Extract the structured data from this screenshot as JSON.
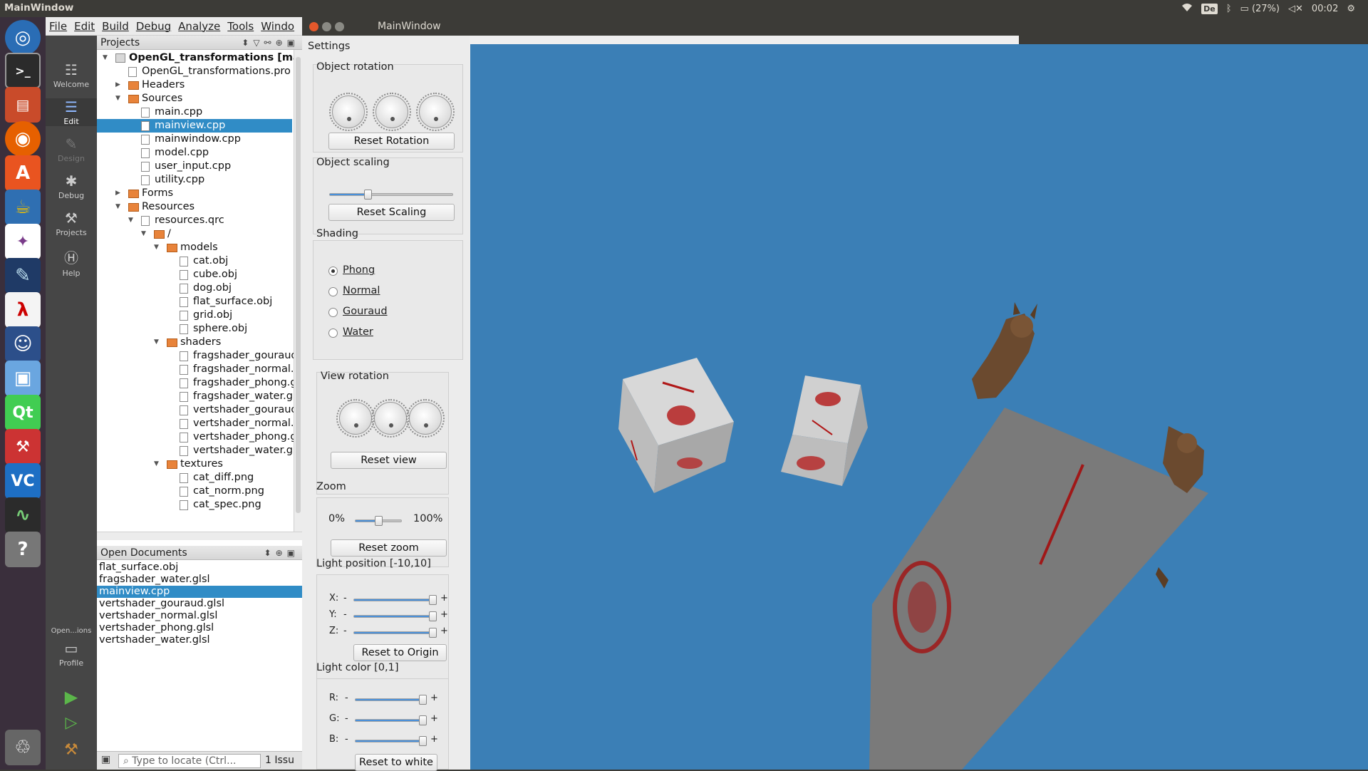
{
  "topbar": {
    "title": "MainWindow",
    "kb": "De",
    "battery": "(27%)",
    "time": "00:02"
  },
  "menu": [
    "File",
    "Edit",
    "Build",
    "Debug",
    "Analyze",
    "Tools",
    "Windo"
  ],
  "modes": [
    "Welcome",
    "Edit",
    "Design",
    "Debug",
    "Projects",
    "Help",
    "Open...ions",
    "Profile"
  ],
  "projects": {
    "header": "Projects",
    "tree": [
      {
        "label": "OpenGL_transformations [maste",
        "level": 0,
        "arrow": "open",
        "icon": "proj",
        "bold": true
      },
      {
        "label": "OpenGL_transformations.pro",
        "level": 1,
        "arrow": "",
        "icon": "file"
      },
      {
        "label": "Headers",
        "level": 1,
        "arrow": "closed",
        "icon": "folder"
      },
      {
        "label": "Sources",
        "level": 1,
        "arrow": "open",
        "icon": "folder"
      },
      {
        "label": "main.cpp",
        "level": 2,
        "arrow": "",
        "icon": "file"
      },
      {
        "label": "mainview.cpp",
        "level": 2,
        "arrow": "",
        "icon": "file",
        "selected": true
      },
      {
        "label": "mainwindow.cpp",
        "level": 2,
        "arrow": "",
        "icon": "file"
      },
      {
        "label": "model.cpp",
        "level": 2,
        "arrow": "",
        "icon": "file"
      },
      {
        "label": "user_input.cpp",
        "level": 2,
        "arrow": "",
        "icon": "file"
      },
      {
        "label": "utility.cpp",
        "level": 2,
        "arrow": "",
        "icon": "file"
      },
      {
        "label": "Forms",
        "level": 1,
        "arrow": "closed",
        "icon": "folder"
      },
      {
        "label": "Resources",
        "level": 1,
        "arrow": "open",
        "icon": "folder"
      },
      {
        "label": "resources.qrc",
        "level": 2,
        "arrow": "open",
        "icon": "file"
      },
      {
        "label": "/",
        "level": 3,
        "arrow": "open",
        "icon": "folder"
      },
      {
        "label": "models",
        "level": 4,
        "arrow": "open",
        "icon": "folder"
      },
      {
        "label": "cat.obj",
        "level": 5,
        "arrow": "",
        "icon": "file"
      },
      {
        "label": "cube.obj",
        "level": 5,
        "arrow": "",
        "icon": "file"
      },
      {
        "label": "dog.obj",
        "level": 5,
        "arrow": "",
        "icon": "file"
      },
      {
        "label": "flat_surface.obj",
        "level": 5,
        "arrow": "",
        "icon": "file"
      },
      {
        "label": "grid.obj",
        "level": 5,
        "arrow": "",
        "icon": "file"
      },
      {
        "label": "sphere.obj",
        "level": 5,
        "arrow": "",
        "icon": "file"
      },
      {
        "label": "shaders",
        "level": 4,
        "arrow": "open",
        "icon": "folder"
      },
      {
        "label": "fragshader_gouraud.",
        "level": 5,
        "arrow": "",
        "icon": "file"
      },
      {
        "label": "fragshader_normal.g",
        "level": 5,
        "arrow": "",
        "icon": "file"
      },
      {
        "label": "fragshader_phong.gl",
        "level": 5,
        "arrow": "",
        "icon": "file"
      },
      {
        "label": "fragshader_water.gls",
        "level": 5,
        "arrow": "",
        "icon": "file"
      },
      {
        "label": "vertshader_gouraud.",
        "level": 5,
        "arrow": "",
        "icon": "file"
      },
      {
        "label": "vertshader_normal.g",
        "level": 5,
        "arrow": "",
        "icon": "file"
      },
      {
        "label": "vertshader_phong.gl",
        "level": 5,
        "arrow": "",
        "icon": "file"
      },
      {
        "label": "vertshader_water.gls",
        "level": 5,
        "arrow": "",
        "icon": "file"
      },
      {
        "label": "textures",
        "level": 4,
        "arrow": "open",
        "icon": "folder"
      },
      {
        "label": "cat_diff.png",
        "level": 5,
        "arrow": "",
        "icon": "file"
      },
      {
        "label": "cat_norm.png",
        "level": 5,
        "arrow": "",
        "icon": "file"
      },
      {
        "label": "cat_spec.png",
        "level": 5,
        "arrow": "",
        "icon": "file"
      }
    ]
  },
  "open_documents": {
    "header": "Open Documents",
    "items": [
      {
        "label": "flat_surface.obj"
      },
      {
        "label": "fragshader_water.glsl"
      },
      {
        "label": "mainview.cpp",
        "selected": true
      },
      {
        "label": "vertshader_gouraud.glsl"
      },
      {
        "label": "vertshader_normal.glsl"
      },
      {
        "label": "vertshader_phong.glsl"
      },
      {
        "label": "vertshader_water.glsl"
      }
    ]
  },
  "statusbar": {
    "locate_placeholder": "Type to locate (Ctrl...",
    "issues": "1  Issu"
  },
  "mainwindow": {
    "title": "MainWindow",
    "settings": {
      "title": "Settings",
      "object_rotation": {
        "label": "Object rotation",
        "reset": "Reset Rotation"
      },
      "object_scaling": {
        "label": "Object scaling",
        "reset": "Reset Scaling",
        "value": 0.3
      },
      "shading": {
        "label": "Shading",
        "options": [
          "Phong",
          "Normal",
          "Gouraud",
          "Water"
        ],
        "selected": "Phong"
      },
      "view_rotation": {
        "label": "View rotation",
        "reset": "Reset view"
      },
      "zoom": {
        "label": "Zoom",
        "min": "0%",
        "max": "100%",
        "reset": "Reset zoom",
        "value": 0.5
      },
      "light_position": {
        "label": "Light position [-10,10]",
        "axes": [
          "X:",
          "Y:",
          "Z:"
        ],
        "values": [
          10,
          10,
          10
        ],
        "minus": "-",
        "plus": "+",
        "reset": "Reset to Origin"
      },
      "light_color": {
        "label": "Light color [0,1]",
        "channels": [
          "R:",
          "G:",
          "B:"
        ],
        "values": [
          1,
          1,
          1
        ],
        "minus": "-",
        "plus": "+",
        "reset": "Reset to white"
      }
    }
  },
  "colors": {
    "viewport": "#3b7fb6",
    "selection": "#308cc6"
  }
}
